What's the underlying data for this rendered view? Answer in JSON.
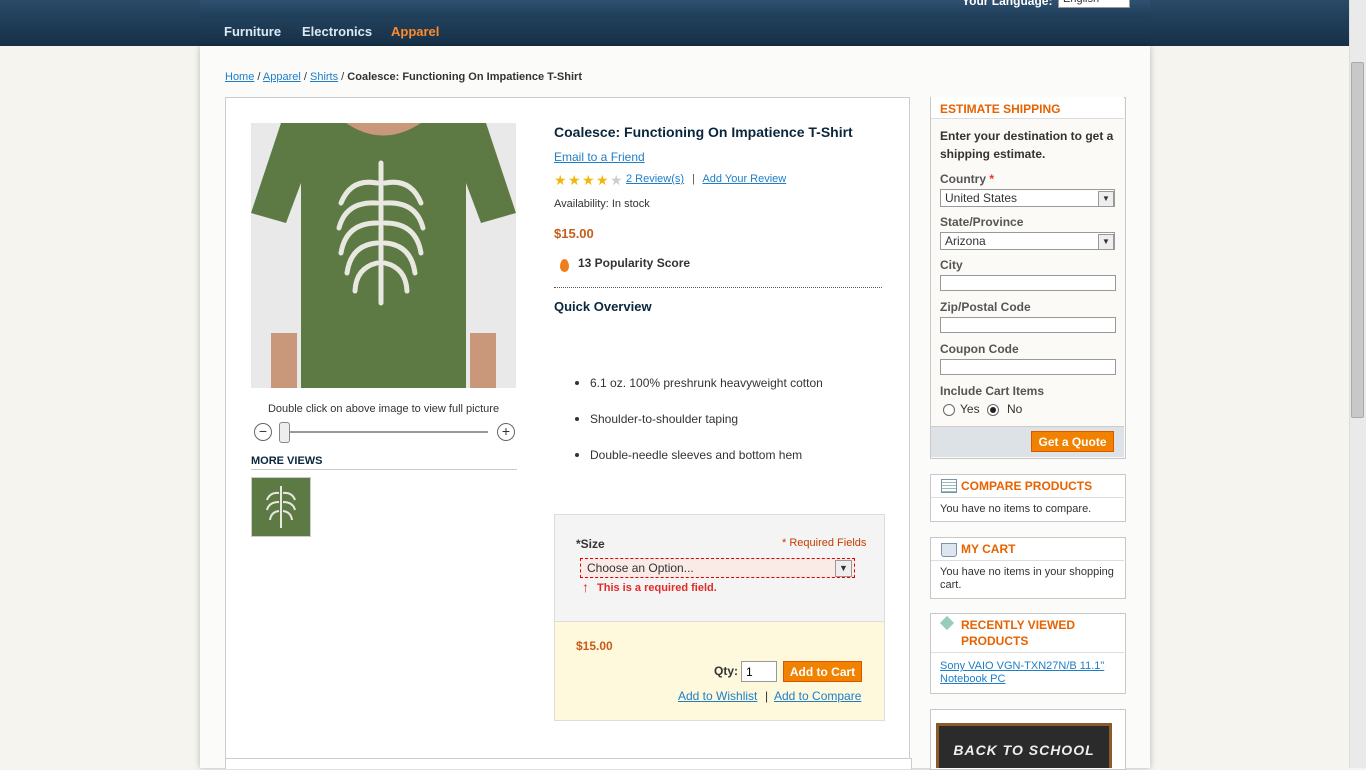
{
  "header": {
    "language_label": "Your Language:",
    "language_value": "English",
    "nav": [
      "Furniture",
      "Electronics",
      "Apparel"
    ],
    "active_nav": "Apparel"
  },
  "breadcrumb": {
    "home": "Home",
    "apparel": "Apparel",
    "shirts": "Shirts",
    "current": "Coalesce: Functioning On Impatience T-Shirt"
  },
  "product": {
    "name": "Coalesce: Functioning On Impatience T-Shirt",
    "email_friend": "Email to a Friend",
    "rating_stars": 4,
    "reviews_link": "2 Review(s)",
    "add_review": "Add Your Review",
    "availability": "Availability: In stock",
    "price": "$15.00",
    "popularity": "13 Popularity Score",
    "overview_title": "Quick Overview",
    "features": [
      "6.1 oz. 100% preshrunk heavyweight cotton",
      "Shoulder-to-shoulder taping",
      "Double-needle sleeves and bottom hem"
    ],
    "zoom_note": "Double click on above image to view full picture",
    "more_views": "MORE VIEWS"
  },
  "options": {
    "size_label": "*Size",
    "required_fields": "* Required Fields",
    "size_placeholder": "Choose an Option...",
    "required_msg": "This is a required field."
  },
  "cart": {
    "price": "$15.00",
    "qty_label": "Qty:",
    "qty_value": "1",
    "add_to_cart": "Add to Cart",
    "wishlist": "Add to Wishlist",
    "separator": "|",
    "compare": "Add to Compare"
  },
  "shipping": {
    "title": "ESTIMATE SHIPPING",
    "intro": "Enter your destination to get a shipping estimate.",
    "country_label": "Country",
    "country_value": "United States",
    "state_label": "State/Province",
    "state_value": "Arizona",
    "city_label": "City",
    "zip_label": "Zip/Postal Code",
    "coupon_label": "Coupon Code",
    "include_label": "Include Cart Items",
    "yes": "Yes",
    "no": "No",
    "include_selected": "No",
    "quote_button": "Get a Quote"
  },
  "compare_block": {
    "title": "COMPARE PRODUCTS",
    "text": "You have no items to compare."
  },
  "cart_block": {
    "title": "MY CART",
    "text": "You have no items in your shopping cart."
  },
  "recent_block": {
    "title_line1": "RECENTLY VIEWED",
    "title_line2": "PRODUCTS",
    "item": "Sony VAIO VGN-TXN27N/B 11.1\" Notebook PC"
  },
  "promo": {
    "text": "BACK TO SCHOOL"
  },
  "colors": {
    "accent": "#f18200",
    "title_orange": "#e76200",
    "link": "#1e7ec8",
    "price": "#c75d1a",
    "nav_bg": "#163048"
  }
}
